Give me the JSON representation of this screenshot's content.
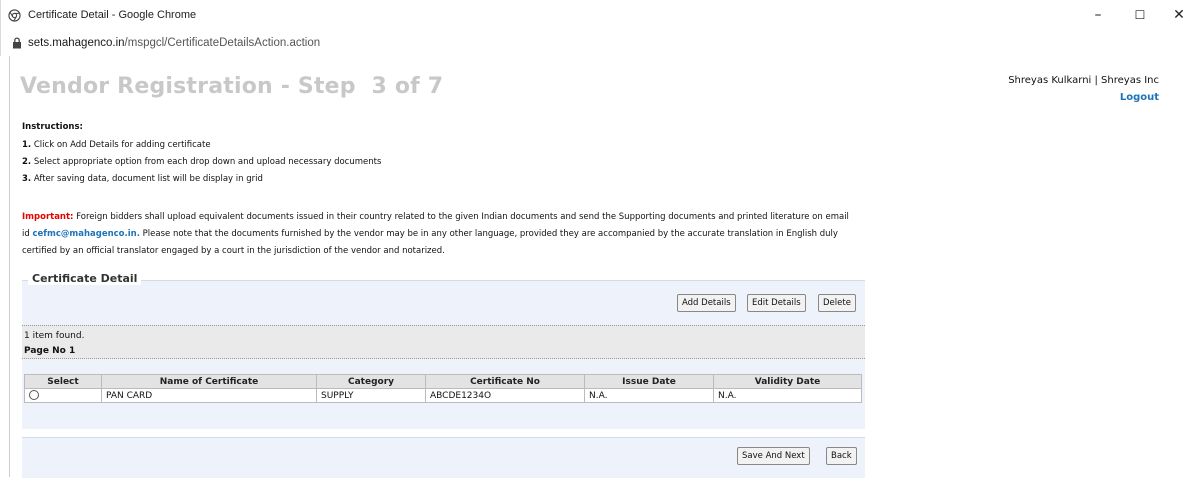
{
  "window": {
    "title": "Certificate Detail - Google Chrome",
    "minimize_label": "–",
    "maximize_label": "☐",
    "close_label": "✕"
  },
  "address": {
    "domain": "sets.mahagenco.in",
    "path": "/mspgcl/CertificateDetailsAction.action"
  },
  "header": {
    "title": "Vendor Registration - Step  3 of 7",
    "user": "Shreyas Kulkarni | Shreyas Inc",
    "logout": "Logout"
  },
  "instructions": {
    "heading": "Instructions:",
    "items": [
      {
        "num": "1.",
        "text": "Click on Add Details for adding certificate"
      },
      {
        "num": "2.",
        "text": "Select appropriate option from each drop down and upload necessary documents"
      },
      {
        "num": "3.",
        "text": "After saving data, document list will be display in grid"
      }
    ]
  },
  "important": {
    "label": "Important:",
    "text1": "Foreign bidders shall upload equivalent documents issued in their country related to the given Indian documents and send the Supporting documents and printed literature on email id",
    "email": "cefmc@mahagenco.in.",
    "text2": "Please note that the documents furnished by the vendor may be in any other language, provided they are accompanied by the accurate translation in English duly certified by an official translator engaged by a court in the jurisdiction of the vendor and notarized."
  },
  "certificate_detail": {
    "legend": "Certificate Detail",
    "buttons": {
      "add": "Add Details",
      "edit": "Edit Details",
      "delete": "Delete"
    },
    "items_found": "1 item found.",
    "page_no": "Page No 1",
    "columns": [
      "Select",
      "Name of Certificate",
      "Category",
      "Certificate No",
      "Issue Date",
      "Validity Date"
    ],
    "rows": [
      {
        "name": "PAN CARD",
        "category": "SUPPLY",
        "cert_no": "ABCDE1234O",
        "issue_date": "N.A.",
        "validity_date": "N.A."
      }
    ]
  },
  "footer": {
    "save_next": "Save And Next",
    "back": "Back"
  },
  "colors": {
    "title_gray": "#c8c8c8",
    "link_blue": "#1e73b9",
    "important_red": "#e60000",
    "panel_blue": "#eef3fb"
  }
}
